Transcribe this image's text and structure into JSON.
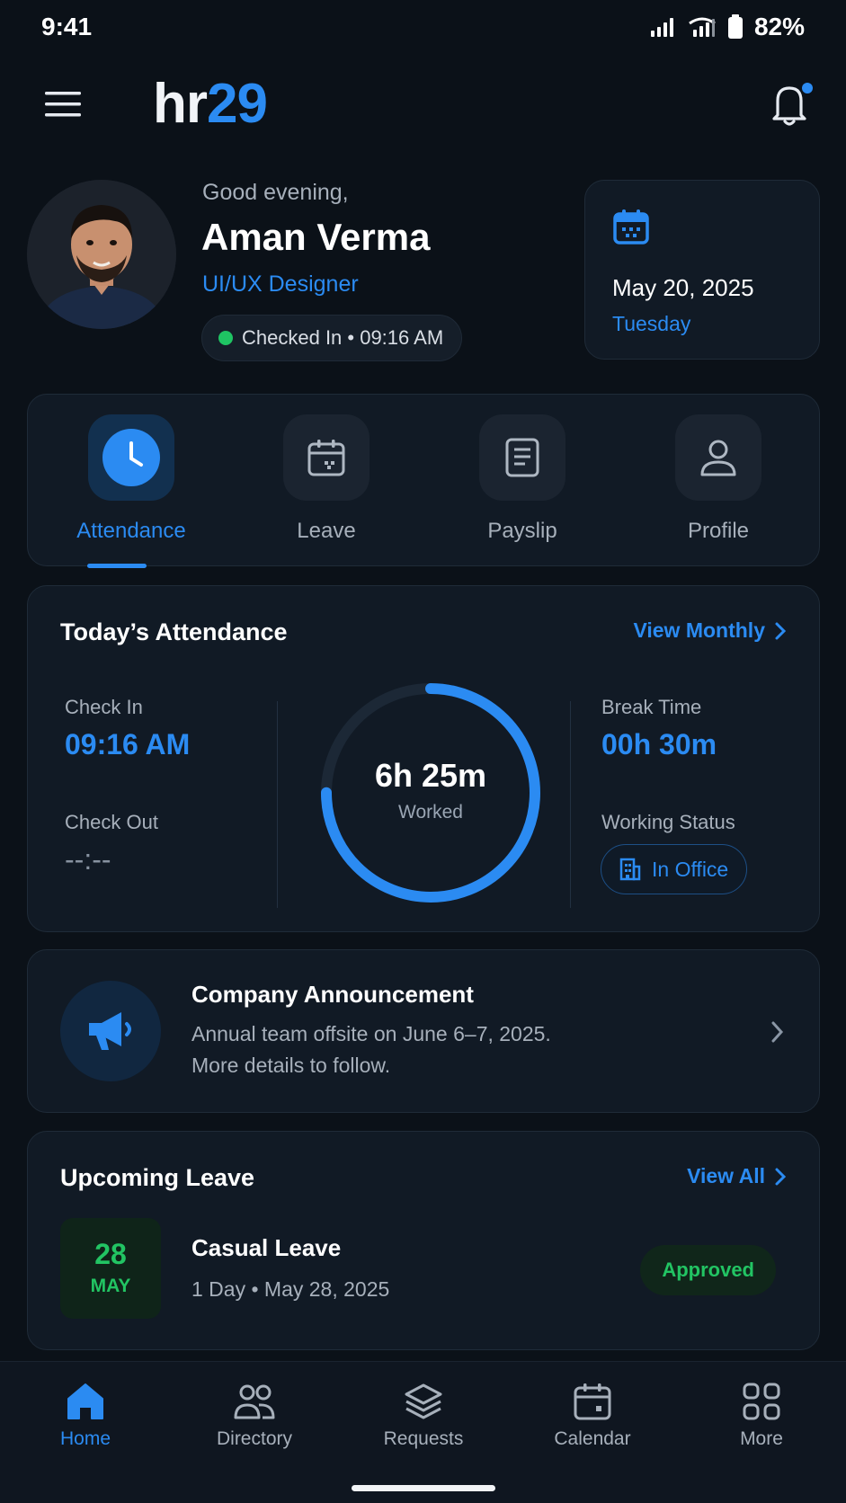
{
  "status_bar": {
    "time": "9:41",
    "battery": "82%"
  },
  "header": {
    "logo_part1": "hr",
    "logo_part2": "29",
    "menu_icon": "menu-icon",
    "bell_icon": "bell-icon"
  },
  "user": {
    "greeting": "Good evening,",
    "name": "Aman Verma",
    "role": "UI/UX Designer",
    "status": "Checked In • 09:16 AM"
  },
  "date_card": {
    "date": "May 20, 2025",
    "day": "Tuesday"
  },
  "quick_actions": [
    {
      "label": "Attendance",
      "icon": "clock-icon",
      "active": true
    },
    {
      "label": "Leave",
      "icon": "calendar-icon",
      "active": false
    },
    {
      "label": "Payslip",
      "icon": "document-icon",
      "active": false
    },
    {
      "label": "Profile",
      "icon": "user-icon",
      "active": false
    }
  ],
  "attendance": {
    "title": "Today’s Attendance",
    "view_link": "View Monthly",
    "check_in_label": "Check In",
    "check_in_value": "09:16 AM",
    "check_out_label": "Check Out",
    "check_out_value": "--:--",
    "worked_value": "6h 25m",
    "worked_label": "Worked",
    "worked_progress": 0.75,
    "break_label": "Break Time",
    "break_value": "00h 30m",
    "working_status_label": "Working Status",
    "working_status_value": "In Office"
  },
  "announcement": {
    "title": "Company Announcement",
    "line1": "Annual team offsite on June 6–7, 2025.",
    "line2": "More details to follow."
  },
  "upcoming_leave": {
    "title": "Upcoming Leave",
    "view_link": "View All",
    "day": "28",
    "month": "MAY",
    "type": "Casual Leave",
    "detail": "1 Day • May 28, 2025",
    "status": "Approved"
  },
  "bottom_nav": [
    {
      "label": "Home",
      "icon": "home-icon",
      "active": true
    },
    {
      "label": "Directory",
      "icon": "people-icon",
      "active": false
    },
    {
      "label": "Requests",
      "icon": "layers-icon",
      "active": false
    },
    {
      "label": "Calendar",
      "icon": "calendar-icon",
      "active": false
    },
    {
      "label": "More",
      "icon": "grid-icon",
      "active": false
    }
  ],
  "colors": {
    "accent": "#2b8bf2",
    "success": "#22c463",
    "background": "#0b1118",
    "card": "#111a25"
  }
}
